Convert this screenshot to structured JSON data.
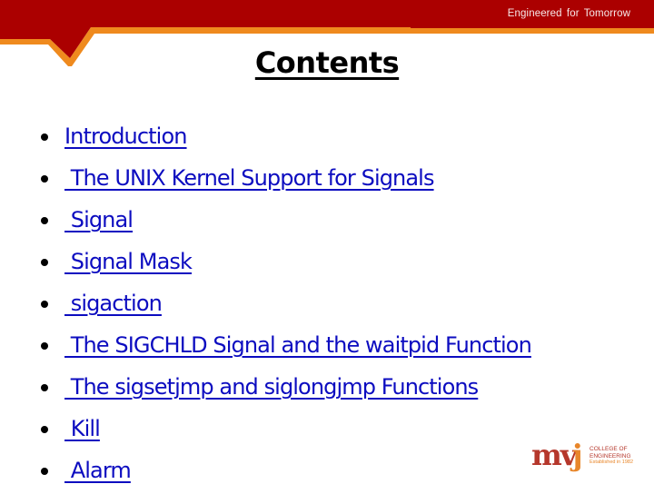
{
  "header": {
    "tagline": "Engineered  for Tomorrow",
    "colors": {
      "band": "#ab0000",
      "accent": "#ef8a1e"
    }
  },
  "slide": {
    "title": "Contents",
    "items": [
      {
        "label": "Introduction"
      },
      {
        "label": " The UNIX Kernel Support for Signals"
      },
      {
        "label": " Signal"
      },
      {
        "label": " Signal Mask"
      },
      {
        "label": " sigaction"
      },
      {
        "label": " The SIGCHLD Signal and the waitpid Function"
      },
      {
        "label": " The sigsetjmp and siglongjmp Functions"
      },
      {
        "label": " Kill"
      },
      {
        "label": " Alarm"
      }
    ],
    "link_color": "#0c0cc0"
  },
  "logo": {
    "mark_mv": "mv",
    "mark_j": "j",
    "line1": "COLLEGE OF",
    "line2": "ENGINEERING",
    "line3": "Established in 1982"
  }
}
